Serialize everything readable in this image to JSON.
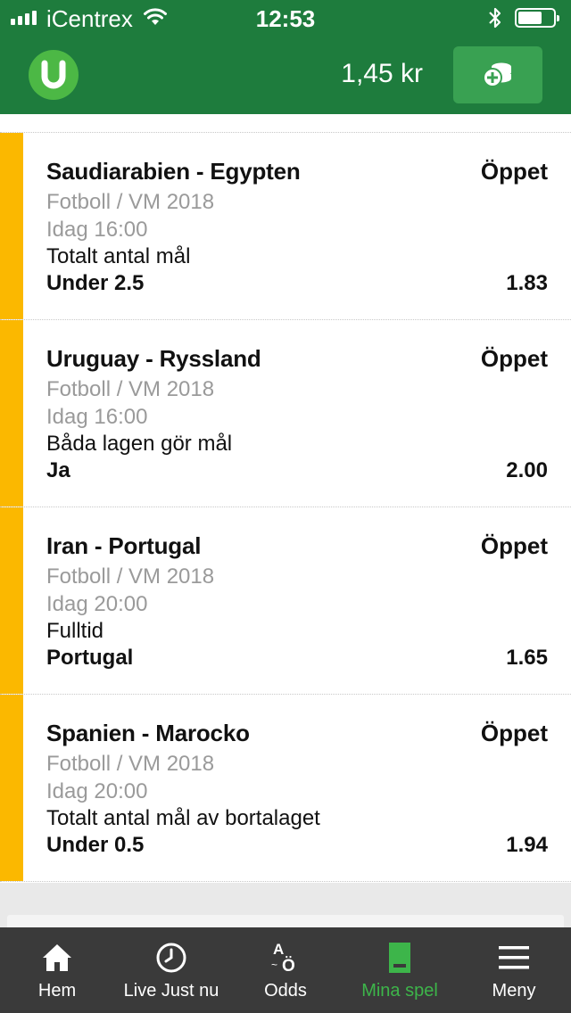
{
  "status_bar": {
    "carrier": "iCentrex",
    "time": "12:53"
  },
  "header": {
    "balance": "1,45 kr",
    "logo_letter": "U",
    "deposit_icon": "coins-plus-icon"
  },
  "bets": [
    {
      "match": "Saudiarabien - Egypten",
      "status": "Öppet",
      "league": "Fotboll / VM 2018",
      "time": "Idag 16:00",
      "market": "Totalt antal mål",
      "selection": "Under 2.5",
      "odds": "1.83"
    },
    {
      "match": "Uruguay - Ryssland",
      "status": "Öppet",
      "league": "Fotboll / VM 2018",
      "time": "Idag 16:00",
      "market": "Båda lagen gör mål",
      "selection": "Ja",
      "odds": "2.00"
    },
    {
      "match": "Iran - Portugal",
      "status": "Öppet",
      "league": "Fotboll / VM 2018",
      "time": "Idag 20:00",
      "market": "Fulltid",
      "selection": "Portugal",
      "odds": "1.65"
    },
    {
      "match": "Spanien - Marocko",
      "status": "Öppet",
      "league": "Fotboll / VM 2018",
      "time": "Idag 20:00",
      "market": "Totalt antal mål av bortalaget",
      "selection": "Under 0.5",
      "odds": "1.94"
    }
  ],
  "tabbar": {
    "items": [
      {
        "label": "Hem",
        "icon": "home-icon"
      },
      {
        "label": "Live Just nu",
        "icon": "clock-icon"
      },
      {
        "label": "Odds",
        "icon": "odds-icon"
      },
      {
        "label": "Mina spel",
        "icon": "bet-slip-icon",
        "active": true
      },
      {
        "label": "Meny",
        "icon": "hamburger-menu-icon"
      }
    ],
    "active_color": "#3db54a"
  },
  "colors": {
    "brand_green": "#1e7c3d",
    "logo_green": "#4cb845",
    "stripe_yellow": "#fbb800",
    "tabbar_bg": "#3a3a3a"
  }
}
